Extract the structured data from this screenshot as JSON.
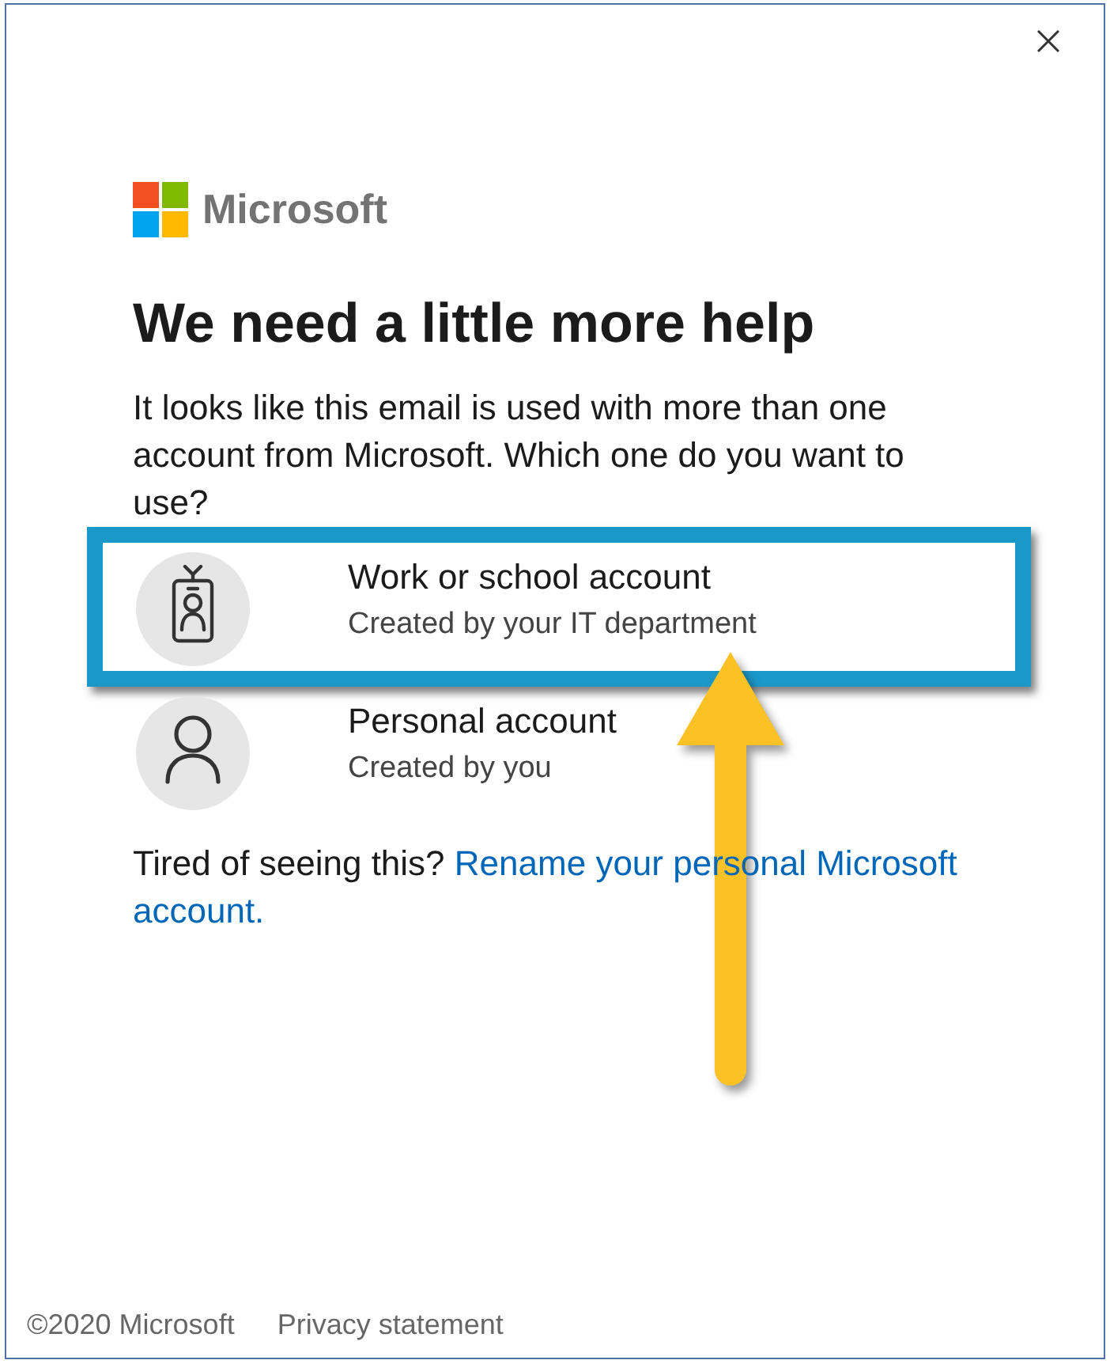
{
  "brand": {
    "name": "Microsoft"
  },
  "heading": "We need a little more help",
  "message": "It looks like this email is used with more than one account from Microsoft. Which one do you want to use?",
  "accounts": [
    {
      "kind": "work",
      "title": "Work or school account",
      "subtitle": "Created by your IT department",
      "highlighted": true
    },
    {
      "kind": "personal",
      "title": "Personal account",
      "subtitle": "Created by you",
      "highlighted": false
    }
  ],
  "rename_prompt": {
    "text": "Tired of seeing this?",
    "link_lines": [
      "Rename your personal Microsoft",
      "account."
    ]
  },
  "footer": {
    "copyright": "©2020 Microsoft",
    "links": [
      "Privacy statement"
    ]
  }
}
